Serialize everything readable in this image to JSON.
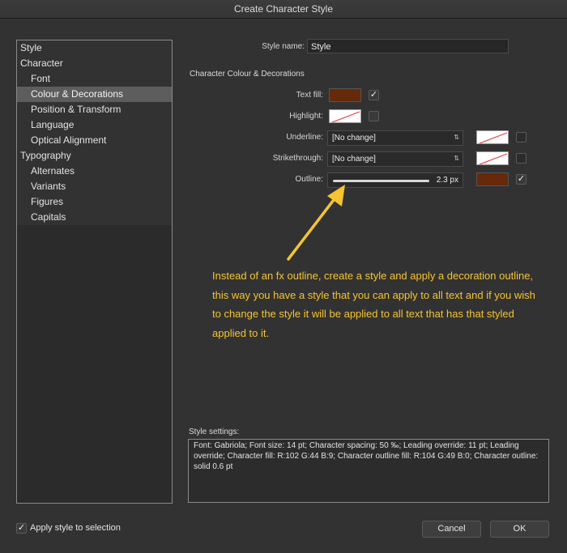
{
  "window": {
    "title": "Create Character Style"
  },
  "sidebar": {
    "items": [
      {
        "label": "Style",
        "level": 0,
        "selected": false
      },
      {
        "label": "Character",
        "level": 0,
        "selected": false
      },
      {
        "label": "Font",
        "level": 1,
        "selected": false
      },
      {
        "label": "Colour & Decorations",
        "level": 1,
        "selected": true
      },
      {
        "label": "Position & Transform",
        "level": 1,
        "selected": false
      },
      {
        "label": "Language",
        "level": 1,
        "selected": false
      },
      {
        "label": "Optical Alignment",
        "level": 1,
        "selected": false
      },
      {
        "label": "Typography",
        "level": 0,
        "selected": false
      },
      {
        "label": "Alternates",
        "level": 1,
        "selected": false
      },
      {
        "label": "Variants",
        "level": 1,
        "selected": false
      },
      {
        "label": "Figures",
        "level": 1,
        "selected": false
      },
      {
        "label": "Capitals",
        "level": 1,
        "selected": false
      }
    ]
  },
  "style_name": {
    "label": "Style name:",
    "value": "Style"
  },
  "section": {
    "title": "Character Colour & Decorations"
  },
  "text_fill": {
    "label": "Text fill:",
    "color": "#66290a",
    "checked": true,
    "check_glyph": "✓"
  },
  "highlight": {
    "label": "Highlight:",
    "swatch": "none",
    "checked": false
  },
  "underline": {
    "label": "Underline:",
    "value": "[No change]",
    "swatch": "none",
    "checked": false
  },
  "strikethrough": {
    "label": "Strikethrough:",
    "value": "[No change]",
    "swatch": "none",
    "checked": false
  },
  "outline": {
    "label": "Outline:",
    "value": "2.3 px",
    "color": "#66290a",
    "checked": true,
    "check_glyph": "✓"
  },
  "annotation": {
    "text": "Instead of an fx outline, create a style and apply a decoration outline, this way you have a style that you can apply to all text and if you wish to change the style it will be applied to all text that has that styled applied to it.",
    "color": "#f5c430"
  },
  "style_settings": {
    "label": "Style settings:",
    "text": "Font: Gabriola; Font size: 14 pt; Character spacing: 50 ‰; Leading override: 11 pt; Leading override; Character fill: R:102 G:44 B:9; Character outline fill: R:104 G:49 B:0; Character outline: solid 0.6 pt"
  },
  "apply_to_selection": {
    "label": "Apply style to selection",
    "checked": true,
    "check_glyph": "✓"
  },
  "buttons": {
    "cancel": "Cancel",
    "ok": "OK"
  },
  "icons": {
    "updown": "⇅"
  }
}
